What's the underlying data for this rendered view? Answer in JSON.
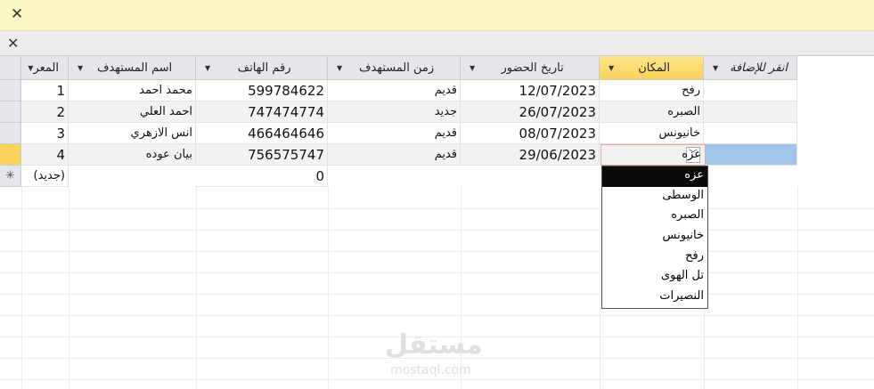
{
  "message_bar": {
    "close": "✕"
  },
  "tab_bar": {
    "close": "✕"
  },
  "columns": [
    "المعر",
    "اسم المستهدف",
    "رقم الهاتف",
    "زمن المستهدف",
    "تاريخ الحضور",
    "المكان",
    "انقر للإضافة"
  ],
  "rows": [
    {
      "id": "1",
      "name": "محمد احمد",
      "phone": "599784622",
      "time": "قديم",
      "date": "12/07/2023",
      "place": "رفح"
    },
    {
      "id": "2",
      "name": "احمد العلي",
      "phone": "747474774",
      "time": "جديد",
      "date": "26/07/2023",
      "place": "الصبره"
    },
    {
      "id": "3",
      "name": "انس الازهري",
      "phone": "466464646",
      "time": "قديم",
      "date": "08/07/2023",
      "place": "خانيونس"
    },
    {
      "id": "4",
      "name": "بيان عوده",
      "phone": "756575747",
      "time": "قديم",
      "date": "29/06/2023",
      "place": "عزه"
    }
  ],
  "new_row": {
    "id": "(جديد)",
    "phone": "0",
    "marker": "✳"
  },
  "dropdown": {
    "options": [
      "عزه",
      "الوسطى",
      "الصبره",
      "خانيونس",
      "رفح",
      "تل الهوى",
      "النصيرات"
    ],
    "selected": "عزه"
  },
  "watermark": {
    "logo": "مستقل",
    "url": "mostaql.com"
  }
}
